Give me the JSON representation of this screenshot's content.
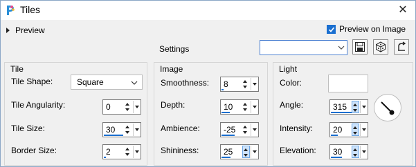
{
  "window": {
    "title": "Tiles"
  },
  "toolbar": {
    "preview_label": "Preview",
    "preview_on_image_label": "Preview on Image",
    "preview_on_image_checked": true,
    "settings_label": "Settings",
    "settings_value": ""
  },
  "tile": {
    "title": "Tile",
    "shape_label": "Tile Shape:",
    "shape_value": "Square",
    "angularity_label": "Tile Angularity:",
    "angularity_value": "0",
    "size_label": "Tile Size:",
    "size_value": "30",
    "border_label": "Border Size:",
    "border_value": "2"
  },
  "image": {
    "title": "Image",
    "smoothness_label": "Smoothness:",
    "smoothness_value": "8",
    "depth_label": "Depth:",
    "depth_value": "10",
    "ambience_label": "Ambience:",
    "ambience_value": "-25",
    "shininess_label": "Shininess:",
    "shininess_value": "25"
  },
  "light": {
    "title": "Light",
    "color_label": "Color:",
    "color_value": "#ffffff",
    "angle_label": "Angle:",
    "angle_value": "315",
    "intensity_label": "Intensity:",
    "intensity_value": "20",
    "elevation_label": "Elevation:",
    "elevation_value": "30"
  },
  "colors": {
    "accent": "#1a6fd0",
    "border": "#8aa6c6"
  }
}
